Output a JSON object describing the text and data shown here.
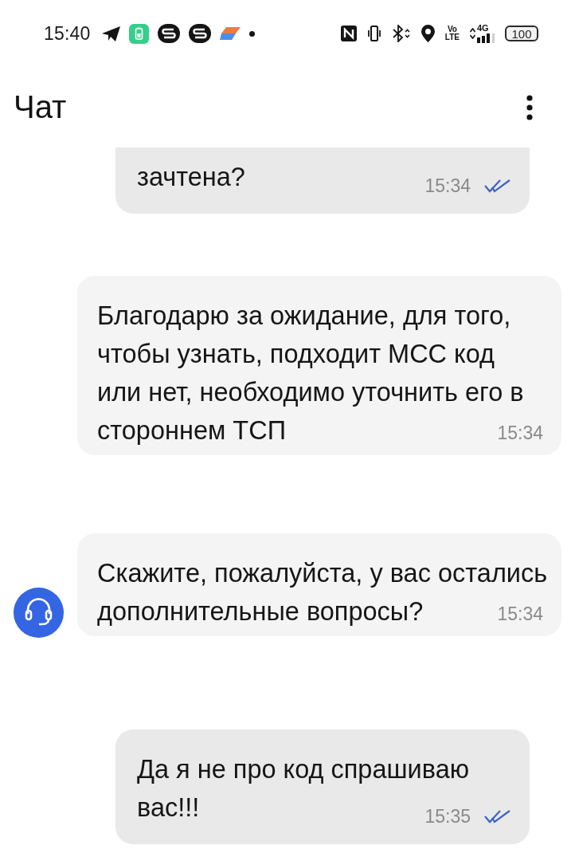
{
  "status_bar": {
    "time": "15:40",
    "volte": [
      "Vo",
      "LTE"
    ],
    "network": "4G",
    "battery": "100"
  },
  "header": {
    "title": "Чат"
  },
  "messages": [
    {
      "kind": "outgoing",
      "cut_off": true,
      "lines": [
        "зачтена?"
      ],
      "time": "15:34",
      "read": true
    },
    {
      "kind": "incoming",
      "cut_off": false,
      "lines": [
        "Благодарю за ожидание, для того,",
        "чтобы узнать, подходит МСС код",
        "или нет, необходимо уточнить его в",
        "стороннем ТСП"
      ],
      "time": "15:34",
      "avatar": false
    },
    {
      "kind": "incoming",
      "cut_off": false,
      "lines": [
        "Скажите, пожалуйста, у вас остались",
        "дополнительные вопросы?"
      ],
      "time": "15:34",
      "avatar": true
    },
    {
      "kind": "outgoing",
      "cut_off": false,
      "lines": [
        "Да я не про код спрашиваю",
        "вас!!!"
      ],
      "time": "15:35",
      "read": true
    }
  ]
}
